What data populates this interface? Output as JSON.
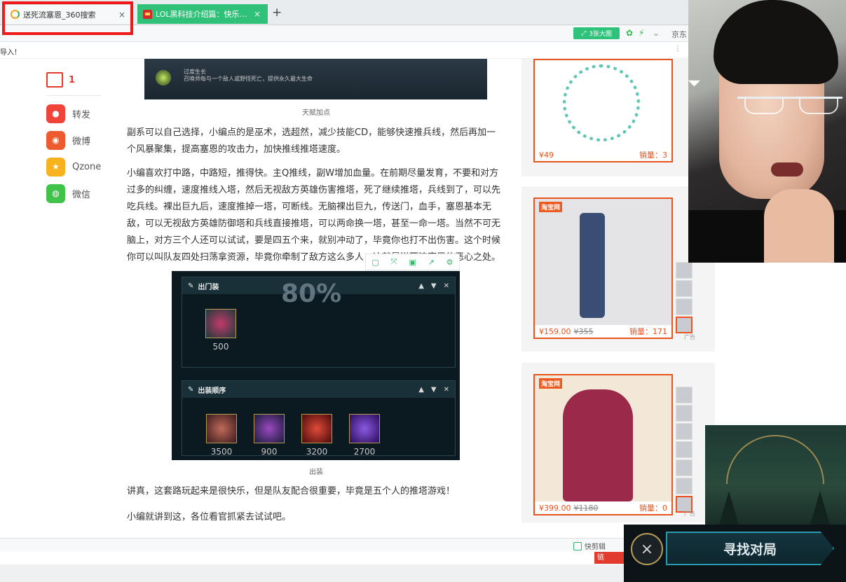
{
  "tabs": [
    {
      "label": "送死流塞恩_360搜索",
      "close": "×"
    },
    {
      "label": "LOL黑科技介绍篇：快乐送死流",
      "close": "×"
    }
  ],
  "new_tab": "+",
  "toolbar": {
    "big_image_label": "3张大图",
    "right_text": "京东"
  },
  "bookmarks": {
    "import_text": "导入！",
    "more": "⋮"
  },
  "share": {
    "comment_count": "1",
    "items": [
      {
        "label": "转发",
        "color": "#f0443a"
      },
      {
        "label": "微博",
        "color": "#ee5a2f"
      },
      {
        "label": "Qzone",
        "color": "#f6b21f"
      },
      {
        "label": "微信",
        "color": "#41c24b"
      }
    ]
  },
  "article": {
    "top_figure_text": "过度生长\n召唤师每与一个敌人或野怪死亡，提供永久最大生命",
    "top_caption": "天赋加点",
    "p1": "副系可以自己选择，小编点的是巫术，选超然，减少技能CD，能够快速推兵线，然后再加一个风暴聚集，提高塞恩的攻击力，加快推线推塔速度。",
    "p2": "小编喜欢打中路，中路短，推得快。主Q推线，副W增加血量。在前期尽量发育，不要和对方过多的纠缠，速度推线入塔，然后无视敌方英雄伤害推塔，死了继续推塔，兵线到了，可以先吃兵线。裸出巨九后，速度推掉一塔，可断线。无脑裸出巨九，传送门，血手，塞恩基本无敌，可以无视敌方英雄防御塔和兵线直接推塔，可以两命换一塔，甚至一命一塔。当然不可无脑上，对方三个人还可以试试，要是四五个来，就别冲动了，毕竟你也打不出伤害。这个时候你可以叫队友四处扫荡拿资源，毕竟你牵制了敌方这么多人，这就是送死流塞恩的恶心之处。",
    "main_caption": "出装",
    "p3": "讲真，这套路玩起来是很快乐，但是队友配合很重要，毕竟是五个人的推塔游戏！",
    "p4": "小编就讲到这，各位看官抓紧去试试吧。"
  },
  "item_build": {
    "percent": "80%",
    "panel1_title": "出门装",
    "panel2_title": "出装顺序",
    "starter": {
      "price": "500"
    },
    "items": [
      {
        "price": "3500",
        "color": "#7a2a2a"
      },
      {
        "price": "900",
        "color": "#3a2a6a"
      },
      {
        "price": "3200",
        "color": "#8a1a1a"
      },
      {
        "price": "2700",
        "color": "#4a2a8a"
      }
    ]
  },
  "ads": [
    {
      "price": "¥49",
      "orig": "",
      "sales": "销量：3"
    },
    {
      "price": "¥159.00",
      "orig": "¥355",
      "sales": "销量：171",
      "brand": "淘宝网",
      "tag": "广告"
    },
    {
      "price": "¥399.00",
      "orig": "¥1180",
      "sales": "销量：0",
      "brand": "淘宝网",
      "tag": "广告"
    }
  ],
  "statusbar": {
    "clip_label": "快剪辑",
    "red_tag": "链"
  },
  "game": {
    "find_match": "寻找对局",
    "close": "×"
  },
  "colors": {
    "accent_green": "#30c178",
    "alert_red": "#f01818",
    "ad_orange": "#e8541e"
  }
}
